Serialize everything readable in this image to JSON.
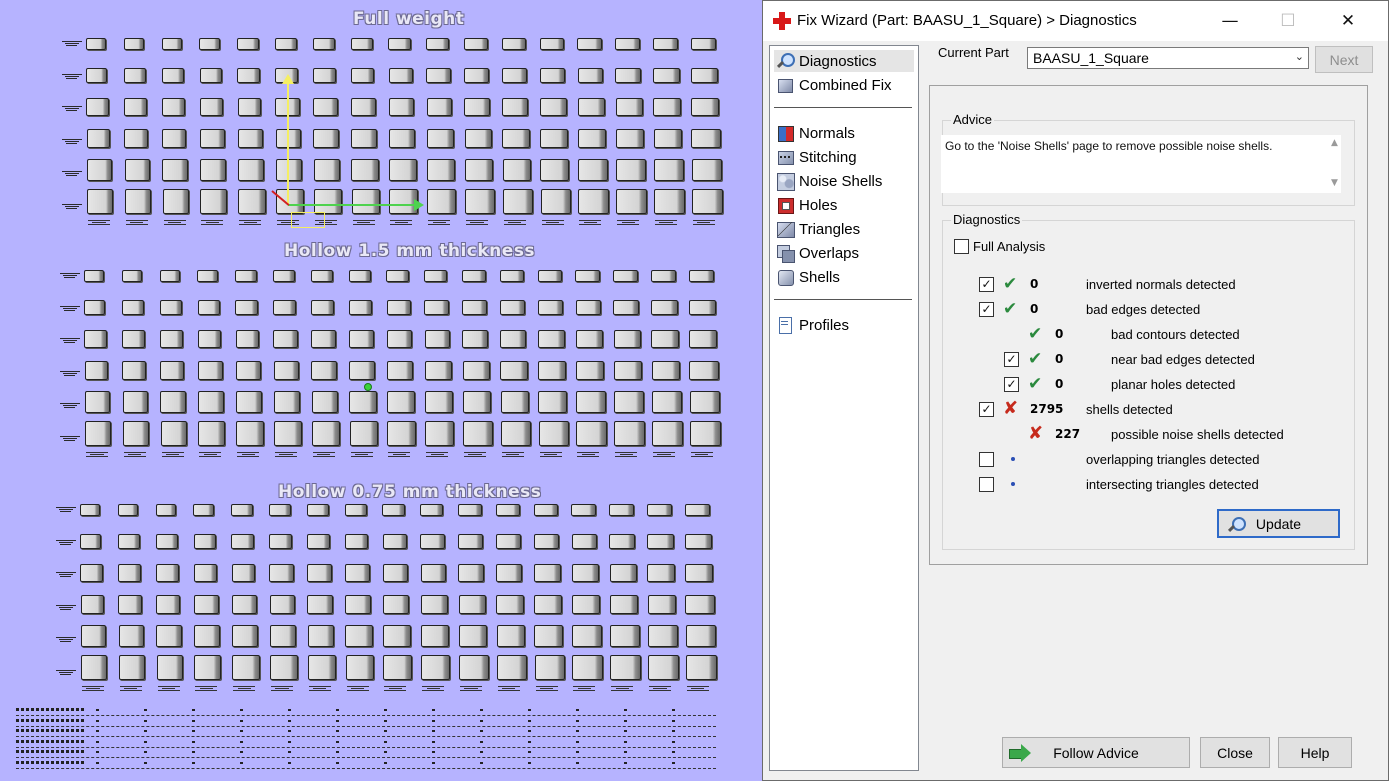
{
  "viewport": {
    "sections": [
      {
        "title": "Full weight"
      },
      {
        "title": "Hollow 1.5 mm thickness"
      },
      {
        "title": "Hollow 0.75 mm thickness"
      }
    ],
    "axes": {
      "x_color": "#4ed24e",
      "y_color": "#f5ef62",
      "z_color": "#d42020"
    },
    "background": "#b6b3ff"
  },
  "dialog": {
    "title": "Fix Wizard (Part: BAASU_1_Square) > Diagnostics",
    "icon": "red-cross-icon",
    "window_buttons": {
      "minimize": "—",
      "maximize": "☐",
      "close": "✕"
    },
    "nav": {
      "top_items": [
        {
          "label": "Diagnostics",
          "icon": "magnifier-icon",
          "selected": true
        },
        {
          "label": "Combined Fix",
          "icon": "combined-fix-icon"
        }
      ],
      "middle_items": [
        {
          "label": "Normals",
          "icon": "normals-icon"
        },
        {
          "label": "Stitching",
          "icon": "stitching-icon"
        },
        {
          "label": "Noise Shells",
          "icon": "noise-shells-icon"
        },
        {
          "label": "Holes",
          "icon": "holes-icon"
        },
        {
          "label": "Triangles",
          "icon": "triangles-icon"
        },
        {
          "label": "Overlaps",
          "icon": "overlaps-icon"
        },
        {
          "label": "Shells",
          "icon": "shells-icon"
        }
      ],
      "bottom_items": [
        {
          "label": "Profiles",
          "icon": "profiles-icon"
        }
      ]
    },
    "current_part": {
      "label": "Current Part",
      "value": "BAASU_1_Square"
    },
    "next_button": "Next",
    "advice": {
      "legend": "Advice",
      "text": "Go to the 'Noise Shells' page to remove possible noise shells."
    },
    "diagnostics": {
      "legend": "Diagnostics",
      "full_analysis_label": "Full Analysis",
      "full_analysis_checked": false,
      "rows": [
        {
          "checkbox": "checked",
          "status": "ok",
          "count": "0",
          "label": "inverted normals detected",
          "indent": 0
        },
        {
          "checkbox": "checked",
          "status": "ok",
          "count": "0",
          "label": "bad edges detected",
          "indent": 0
        },
        {
          "checkbox": "none",
          "status": "ok",
          "count": "0",
          "label": "bad contours detected",
          "indent": 1
        },
        {
          "checkbox": "checked",
          "status": "ok",
          "count": "0",
          "label": "near bad edges detected",
          "indent": 1
        },
        {
          "checkbox": "checked",
          "status": "ok",
          "count": "0",
          "label": "planar holes detected",
          "indent": 1
        },
        {
          "checkbox": "checked",
          "status": "bad",
          "count": "2795",
          "label": "shells detected",
          "indent": 0
        },
        {
          "checkbox": "none",
          "status": "bad",
          "count": "227",
          "label": "possible noise shells detected",
          "indent": 1
        },
        {
          "checkbox": "unchecked",
          "status": "dot",
          "count": "",
          "label": "overlapping triangles detected",
          "indent": 0
        },
        {
          "checkbox": "unchecked",
          "status": "dot",
          "count": "",
          "label": "intersecting triangles detected",
          "indent": 0
        }
      ],
      "update_button": "Update"
    },
    "footer": {
      "follow_advice": "Follow Advice",
      "close": "Close",
      "help": "Help"
    },
    "colors": {
      "ok": "#2b8a3e",
      "bad": "#c62a1c",
      "focus": "#2e6ac9"
    }
  }
}
